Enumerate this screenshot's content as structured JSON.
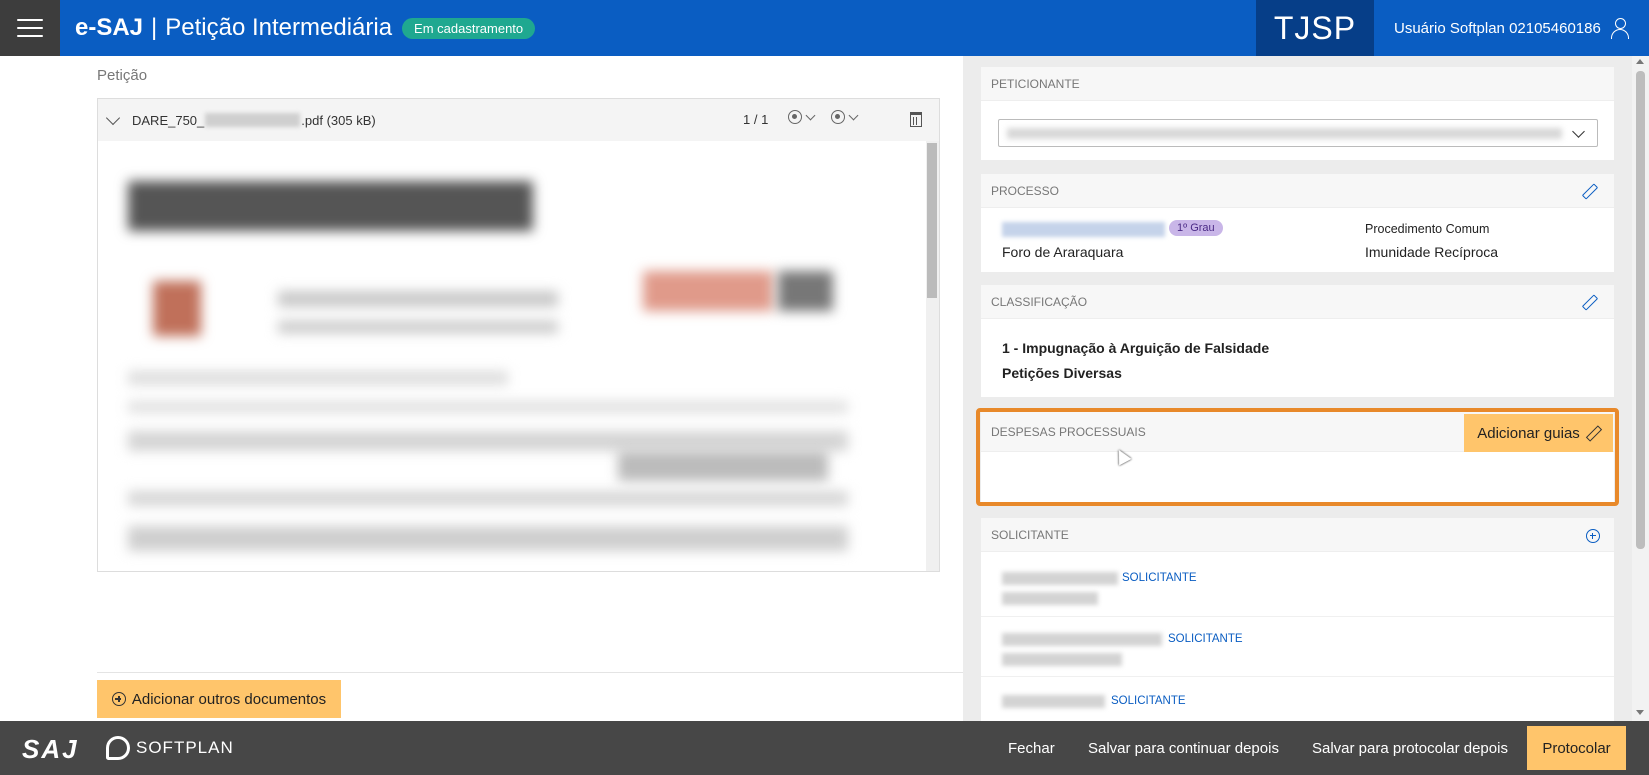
{
  "header": {
    "brand": "e-SAJ",
    "separator": "|",
    "page_title": "Petição Intermediária",
    "status": "Em cadastramento",
    "court": "TJSP",
    "user": "Usuário Softplan 02105460186"
  },
  "left": {
    "section_title": "Petição",
    "document": {
      "name_prefix": "DARE_750_",
      "name_suffix": ".pdf (305 kB)",
      "page_indicator": "1 / 1"
    },
    "add_documents_label": "Adicionar outros documentos"
  },
  "right": {
    "peticionante": {
      "title": "PETICIONANTE"
    },
    "processo": {
      "title": "PROCESSO",
      "grau": "1º Grau",
      "foro": "Foro de Araraquara",
      "procedimento": "Procedimento Comum",
      "assunto": "Imunidade Recíproca"
    },
    "classificacao": {
      "title": "CLASSIFICAÇÃO",
      "line1": "1 - Impugnação à Arguição de Falsidade",
      "line2": "Petições Diversas"
    },
    "despesas": {
      "title": "DESPESAS PROCESSUAIS",
      "add_label": "Adicionar guias"
    },
    "solicitante": {
      "title": "SOLICITANTE",
      "tags": [
        "SOLICITANTE",
        "SOLICITANTE",
        "SOLICITANTE"
      ]
    }
  },
  "footer": {
    "saj_logo": "SAJ",
    "softplan_logo": "SOFTPLAN",
    "fechar": "Fechar",
    "salvar_continuar": "Salvar para continuar depois",
    "salvar_protocolar": "Salvar para protocolar depois",
    "protocolar": "Protocolar"
  },
  "colors": {
    "header_blue": "#0a5dc2",
    "court_blue": "#063e88",
    "status_green": "#1fa890",
    "action_yellow": "#ffc56b",
    "highlight_orange": "#e8892a",
    "footer_gray": "#474747"
  }
}
